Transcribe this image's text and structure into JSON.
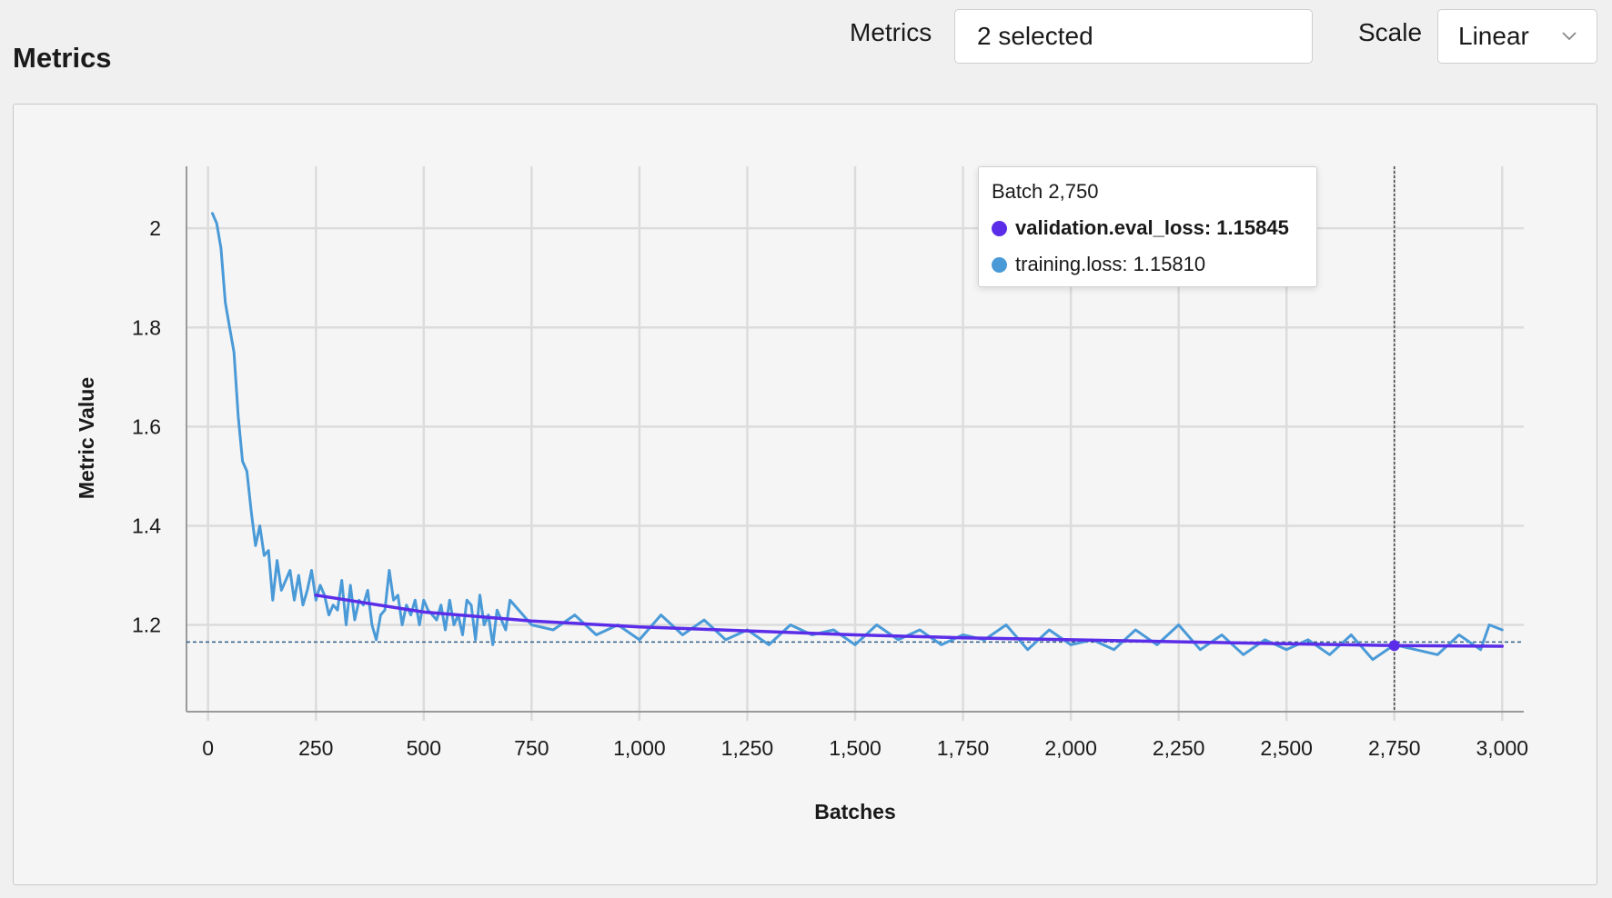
{
  "header": {
    "title": "Metrics",
    "metrics_label": "Metrics",
    "metrics_value": "2 selected",
    "scale_label": "Scale",
    "scale_value": "Linear"
  },
  "tooltip": {
    "title": "Batch 2,750",
    "rows": [
      {
        "text": "validation.eval_loss: 1.15845",
        "color": "#5b2de8",
        "bold": true
      },
      {
        "text": "training.loss: 1.15810",
        "color": "#4a9ad8",
        "bold": false
      }
    ]
  },
  "chart_data": {
    "type": "line",
    "xlabel": "Batches",
    "ylabel": "Metric Value",
    "xlim": [
      -50,
      3050
    ],
    "ylim": [
      1.025,
      2.125
    ],
    "x_ticks": [
      0,
      250,
      500,
      750,
      1000,
      1250,
      1500,
      1750,
      2000,
      2250,
      2500,
      2750,
      3000
    ],
    "x_tick_labels": [
      "0",
      "250",
      "500",
      "750",
      "1,000",
      "1,250",
      "1,500",
      "1,750",
      "2,000",
      "2,250",
      "2,500",
      "2,750",
      "3,000"
    ],
    "y_ticks": [
      1.2,
      1.4,
      1.6,
      1.8,
      2.0
    ],
    "y_tick_labels": [
      "1.2",
      "1.4",
      "1.6",
      "1.8",
      "2"
    ],
    "grid": true,
    "hover_x": 2750,
    "reference_y": 1.1655,
    "series": [
      {
        "name": "training.loss",
        "color": "#4a9ad8",
        "x": [
          10,
          20,
          30,
          40,
          50,
          60,
          70,
          80,
          90,
          100,
          110,
          120,
          130,
          140,
          150,
          160,
          170,
          180,
          190,
          200,
          210,
          220,
          230,
          240,
          250,
          260,
          270,
          280,
          290,
          300,
          310,
          320,
          330,
          340,
          350,
          360,
          370,
          380,
          390,
          400,
          410,
          420,
          430,
          440,
          450,
          460,
          470,
          480,
          490,
          500,
          510,
          520,
          530,
          540,
          550,
          560,
          570,
          580,
          590,
          600,
          610,
          620,
          630,
          640,
          650,
          660,
          670,
          680,
          690,
          700,
          750,
          800,
          850,
          900,
          950,
          1000,
          1050,
          1100,
          1150,
          1200,
          1250,
          1300,
          1350,
          1400,
          1450,
          1500,
          1550,
          1600,
          1650,
          1700,
          1750,
          1800,
          1850,
          1900,
          1950,
          2000,
          2050,
          2100,
          2150,
          2200,
          2250,
          2300,
          2350,
          2400,
          2450,
          2500,
          2550,
          2600,
          2650,
          2700,
          2750,
          2800,
          2850,
          2900,
          2950,
          2970,
          3000
        ],
        "values": [
          2.03,
          2.01,
          1.96,
          1.85,
          1.8,
          1.75,
          1.62,
          1.53,
          1.51,
          1.43,
          1.36,
          1.4,
          1.34,
          1.35,
          1.25,
          1.33,
          1.27,
          1.29,
          1.31,
          1.25,
          1.3,
          1.24,
          1.27,
          1.31,
          1.25,
          1.28,
          1.26,
          1.22,
          1.24,
          1.23,
          1.29,
          1.2,
          1.28,
          1.21,
          1.25,
          1.24,
          1.27,
          1.2,
          1.17,
          1.22,
          1.23,
          1.31,
          1.25,
          1.26,
          1.2,
          1.24,
          1.22,
          1.25,
          1.2,
          1.25,
          1.23,
          1.22,
          1.21,
          1.24,
          1.19,
          1.25,
          1.2,
          1.22,
          1.18,
          1.25,
          1.24,
          1.17,
          1.26,
          1.2,
          1.22,
          1.16,
          1.23,
          1.21,
          1.19,
          1.25,
          1.2,
          1.19,
          1.22,
          1.18,
          1.2,
          1.17,
          1.22,
          1.18,
          1.21,
          1.17,
          1.19,
          1.16,
          1.2,
          1.18,
          1.19,
          1.16,
          1.2,
          1.17,
          1.19,
          1.16,
          1.18,
          1.17,
          1.2,
          1.15,
          1.19,
          1.16,
          1.17,
          1.15,
          1.19,
          1.16,
          1.2,
          1.15,
          1.18,
          1.14,
          1.17,
          1.15,
          1.17,
          1.14,
          1.18,
          1.13,
          1.16,
          1.15,
          1.14,
          1.18,
          1.15,
          1.2,
          1.19
        ]
      },
      {
        "name": "validation.eval_loss",
        "color": "#5b2de8",
        "x": [
          250,
          500,
          750,
          1000,
          1250,
          1500,
          1750,
          2000,
          2250,
          2500,
          2750,
          3000
        ],
        "values": [
          1.26,
          1.226,
          1.208,
          1.196,
          1.188,
          1.18,
          1.174,
          1.17,
          1.166,
          1.162,
          1.15845,
          1.157
        ]
      }
    ]
  }
}
